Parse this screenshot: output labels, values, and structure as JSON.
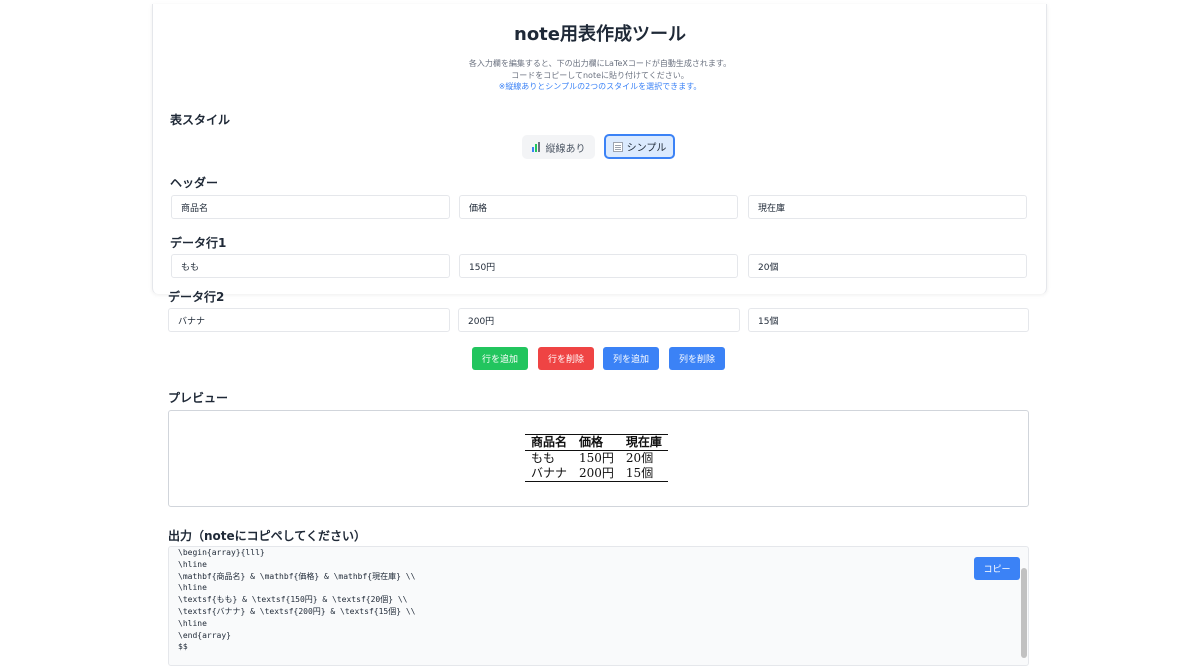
{
  "app": {
    "title": "note用表作成ツール",
    "desc_line1": "各入力欄を編集すると、下の出力欄にLaTeXコードが自動生成されます。",
    "desc_line2": "コードをコピーしてnoteに貼り付けてください。",
    "desc_line3": "※縦線ありとシンプルの2つのスタイルを選択できます。"
  },
  "style_section": {
    "label": "表スタイル",
    "options": [
      {
        "label": "縦線あり",
        "icon": "bar-chart-icon",
        "selected": false
      },
      {
        "label": "シンプル",
        "icon": "memo-icon",
        "selected": true
      }
    ]
  },
  "header_section": {
    "label": "ヘッダー",
    "values": [
      "商品名",
      "価格",
      "現在庫"
    ]
  },
  "rows": [
    {
      "label": "データ行1",
      "values": [
        "もも",
        "150円",
        "20個"
      ]
    },
    {
      "label": "データ行2",
      "values": [
        "バナナ",
        "200円",
        "15個"
      ]
    }
  ],
  "actions": {
    "add_row": "行を追加",
    "delete_row": "行を削除",
    "add_col": "列を追加",
    "delete_col": "列を削除"
  },
  "preview": {
    "label": "プレビュー",
    "headers": [
      "商品名",
      "価格",
      "現在庫"
    ],
    "rows": [
      [
        "もも",
        "150円",
        "20個"
      ],
      [
        "バナナ",
        "200円",
        "15個"
      ]
    ]
  },
  "output": {
    "label": "出力（noteにコピペしてください）",
    "copy_label": "コピー",
    "code": "\\begin{array}{lll}\n\\hline\n\\mathbf{商品名} & \\mathbf{価格} & \\mathbf{現在庫} \\\\\n\\hline\n\\textsf{もも} & \\textsf{150円} & \\textsf{20個} \\\\\n\\textsf{バナナ} & \\textsf{200円} & \\textsf{15個} \\\\\n\\hline\n\\end{array}\n$$"
  },
  "colors": {
    "accent": "#3b82f6",
    "add_row": "#22c55e",
    "delete_row": "#ef4444",
    "selected_bg": "#dbeafe"
  }
}
